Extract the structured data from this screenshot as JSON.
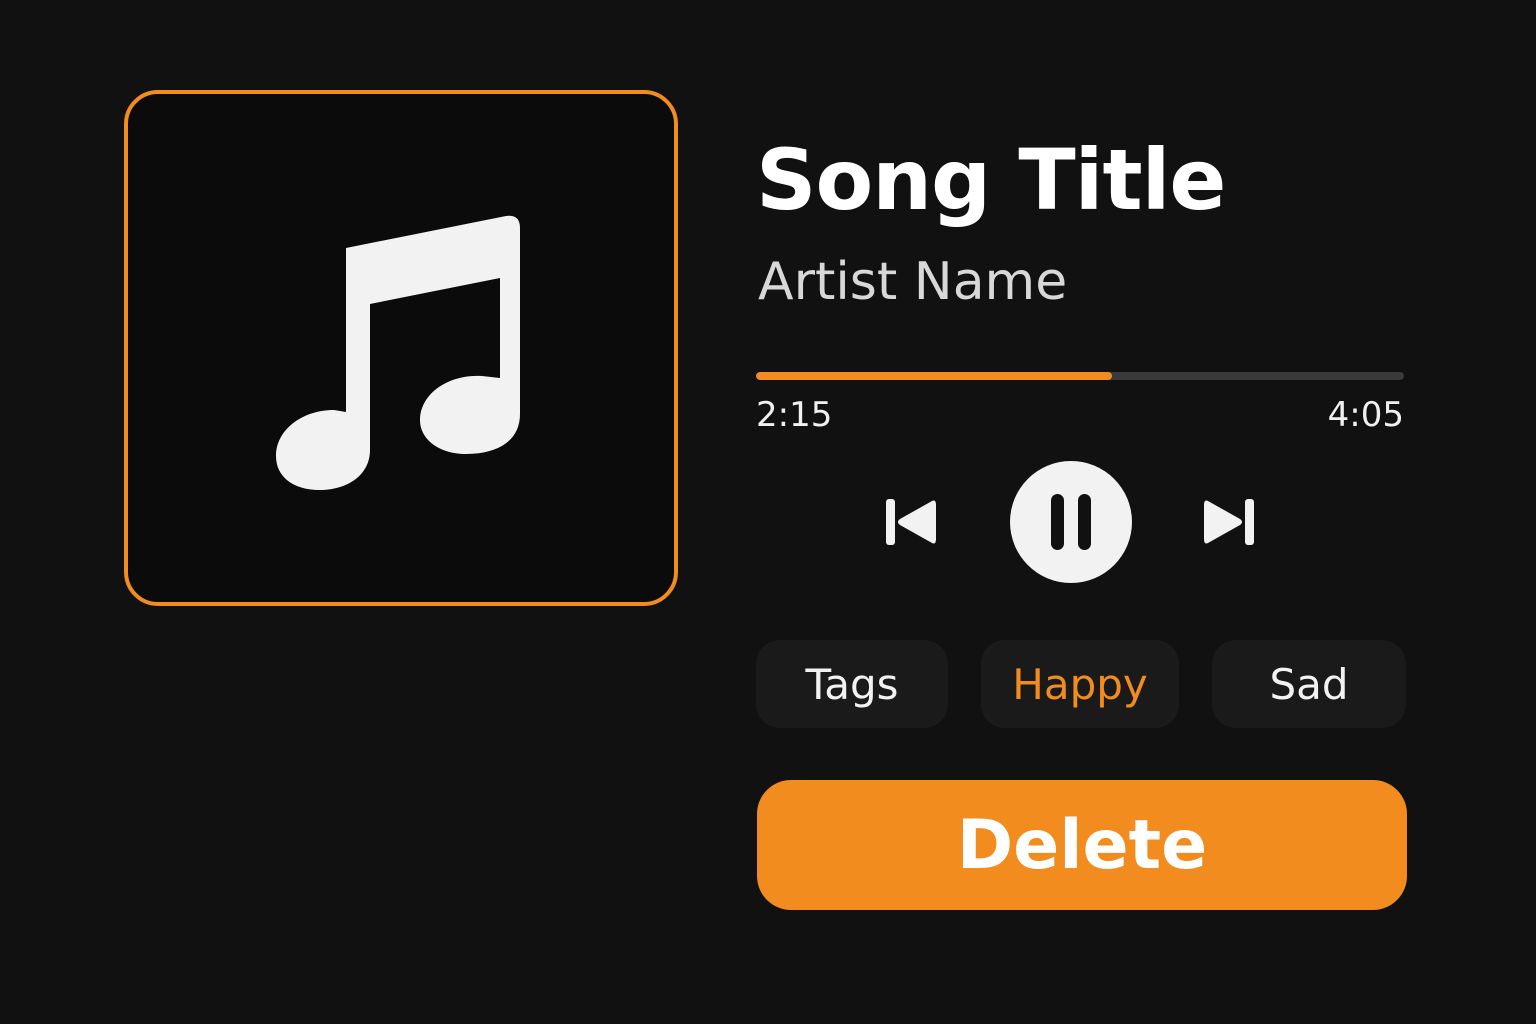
{
  "colors": {
    "background": "#111111",
    "accent": "#f28c1f",
    "text_primary": "#ffffff",
    "text_secondary": "#d8d8d8",
    "chip_background": "#1a1a1a"
  },
  "album_art": {
    "icon": "music-note-icon"
  },
  "track": {
    "title": "Song Title",
    "artist": "Artist Name"
  },
  "playback": {
    "elapsed": "2:15",
    "total": "4:05",
    "progress_fraction": 0.55,
    "state": "playing"
  },
  "controls": {
    "previous_icon": "skip-previous-icon",
    "pause_icon": "pause-icon",
    "next_icon": "skip-next-icon"
  },
  "tags": [
    {
      "label": "Tags",
      "active": false
    },
    {
      "label": "Happy",
      "active": true
    },
    {
      "label": "Sad",
      "active": false
    }
  ],
  "actions": {
    "delete_label": "Delete"
  }
}
